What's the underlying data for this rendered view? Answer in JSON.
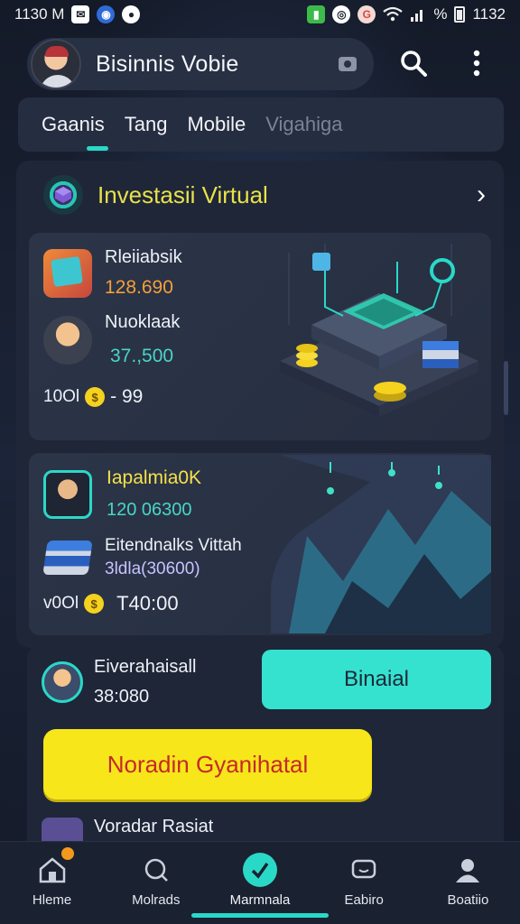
{
  "status_bar": {
    "time": "1130 M",
    "right_text": "%",
    "right_time": "1132",
    "icons": [
      "bird-icon",
      "app-badge-icon",
      "location-icon",
      "green-app-icon",
      "vpn-icon",
      "g-icon",
      "wifi-icon",
      "signal-icon",
      "battery-icon"
    ]
  },
  "header": {
    "title": "Bisinnis Vobie"
  },
  "tabs": [
    {
      "label": "Gaanis",
      "active": true
    },
    {
      "label": "Tang",
      "active": false
    },
    {
      "label": "Mobile",
      "active": false
    },
    {
      "label": "Vigahiga",
      "active": false
    }
  ],
  "section": {
    "title": "Investasii Virtual"
  },
  "card1": {
    "row1": {
      "label": "Rleiiabsik",
      "value": "128.690"
    },
    "row2": {
      "label": "Nuoklaak",
      "value": "37.,500"
    },
    "row3": {
      "prefix": "10Ol",
      "suffix": "- 99",
      "coin": "$"
    }
  },
  "card2": {
    "row1": {
      "label": "Iapalmia0K",
      "value": "120 06300"
    },
    "row2": {
      "label": "Eitendnalks Vittah",
      "value": "3ldla(30600)"
    },
    "row3": {
      "prefix": "v0Ol",
      "suffix": "T40:00",
      "coin": "$"
    }
  },
  "lower": {
    "row1": {
      "label": "Eiverahaisall",
      "value": "38:080"
    },
    "primary_button": "Binaial",
    "yellow_button": "Noradin Gyanihatal",
    "partial_row": "Voradar Rasiat"
  },
  "bottom_nav": [
    {
      "label": "Hleme",
      "icon": "home-icon",
      "active": false,
      "badge": true
    },
    {
      "label": "Molrads",
      "icon": "search-icon",
      "active": false,
      "badge": false
    },
    {
      "label": "Marmnala",
      "icon": "check-icon",
      "active": true,
      "badge": false
    },
    {
      "label": "Eabiro",
      "icon": "chat-icon",
      "active": false,
      "badge": false
    },
    {
      "label": "Boatiio",
      "icon": "profile-icon",
      "active": false,
      "badge": false
    }
  ],
  "colors": {
    "accent_teal": "#35e2d0",
    "accent_yellow": "#f7e61a",
    "title_yellow": "#e9e14a",
    "background": "#161d2e"
  }
}
